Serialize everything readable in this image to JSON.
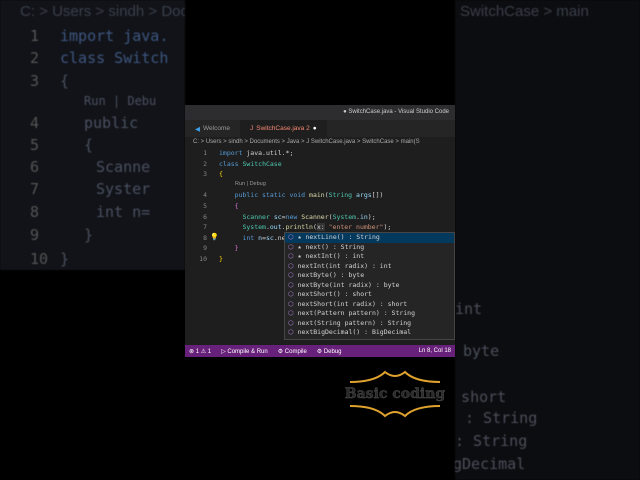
{
  "background": {
    "left_breadcrumb": "C: > Users > sindh > Docu",
    "right_breadcrumb": "SwitchCase > main",
    "left_lines": [
      [
        "1",
        "import java."
      ],
      [
        "2",
        "class Switch"
      ],
      [
        "3",
        "{"
      ],
      [
        "",
        "Run | Debu"
      ],
      [
        "4",
        "public"
      ],
      [
        "5",
        "{"
      ],
      [
        "6",
        "Scanne"
      ],
      [
        "7",
        "Syster"
      ],
      [
        "8",
        "int n="
      ],
      [
        "9",
        "}"
      ],
      [
        "10",
        "}"
      ]
    ],
    "right_texts": [
      "int",
      "byte",
      ": short",
      ": String",
      ": String",
      "gDecimal",
      "\");"
    ]
  },
  "window": {
    "title": "● SwitchCase.java - Visual Studio Code",
    "tabs": [
      {
        "label": "Welcome"
      },
      {
        "label": "SwitchCase.java 2"
      }
    ],
    "breadcrumb": "C: > Users > sindh > Documents > Java > J SwitchCase.java > SwitchCase > main(S",
    "codelens": "Run | Debug",
    "lines": [
      "1",
      "2",
      "3",
      "4",
      "5",
      "6",
      "7",
      "8",
      "9",
      "10"
    ],
    "suggestions": [
      {
        "label": "★ nextLine() : String"
      },
      {
        "label": "★ next() : String"
      },
      {
        "label": "★ nextInt() : int"
      },
      {
        "label": "nextInt(int radix) : int"
      },
      {
        "label": "nextByte() : byte"
      },
      {
        "label": "nextByte(int radix) : byte"
      },
      {
        "label": "nextShort() : short"
      },
      {
        "label": "nextShort(int radix) : short"
      },
      {
        "label": "next(Pattern pattern) : String"
      },
      {
        "label": "next(String pattern) : String"
      },
      {
        "label": "nextBigDecimal() : BigDecimal"
      }
    ],
    "status": {
      "errors": "⊗ 1",
      "warnings": "⚠ 1",
      "compile_run": "▷ Compile & Run",
      "compile": "⚙ Compile",
      "debug": "⚙ Debug",
      "position": "Ln 8, Col 18"
    }
  },
  "watermark": "Basic coding"
}
